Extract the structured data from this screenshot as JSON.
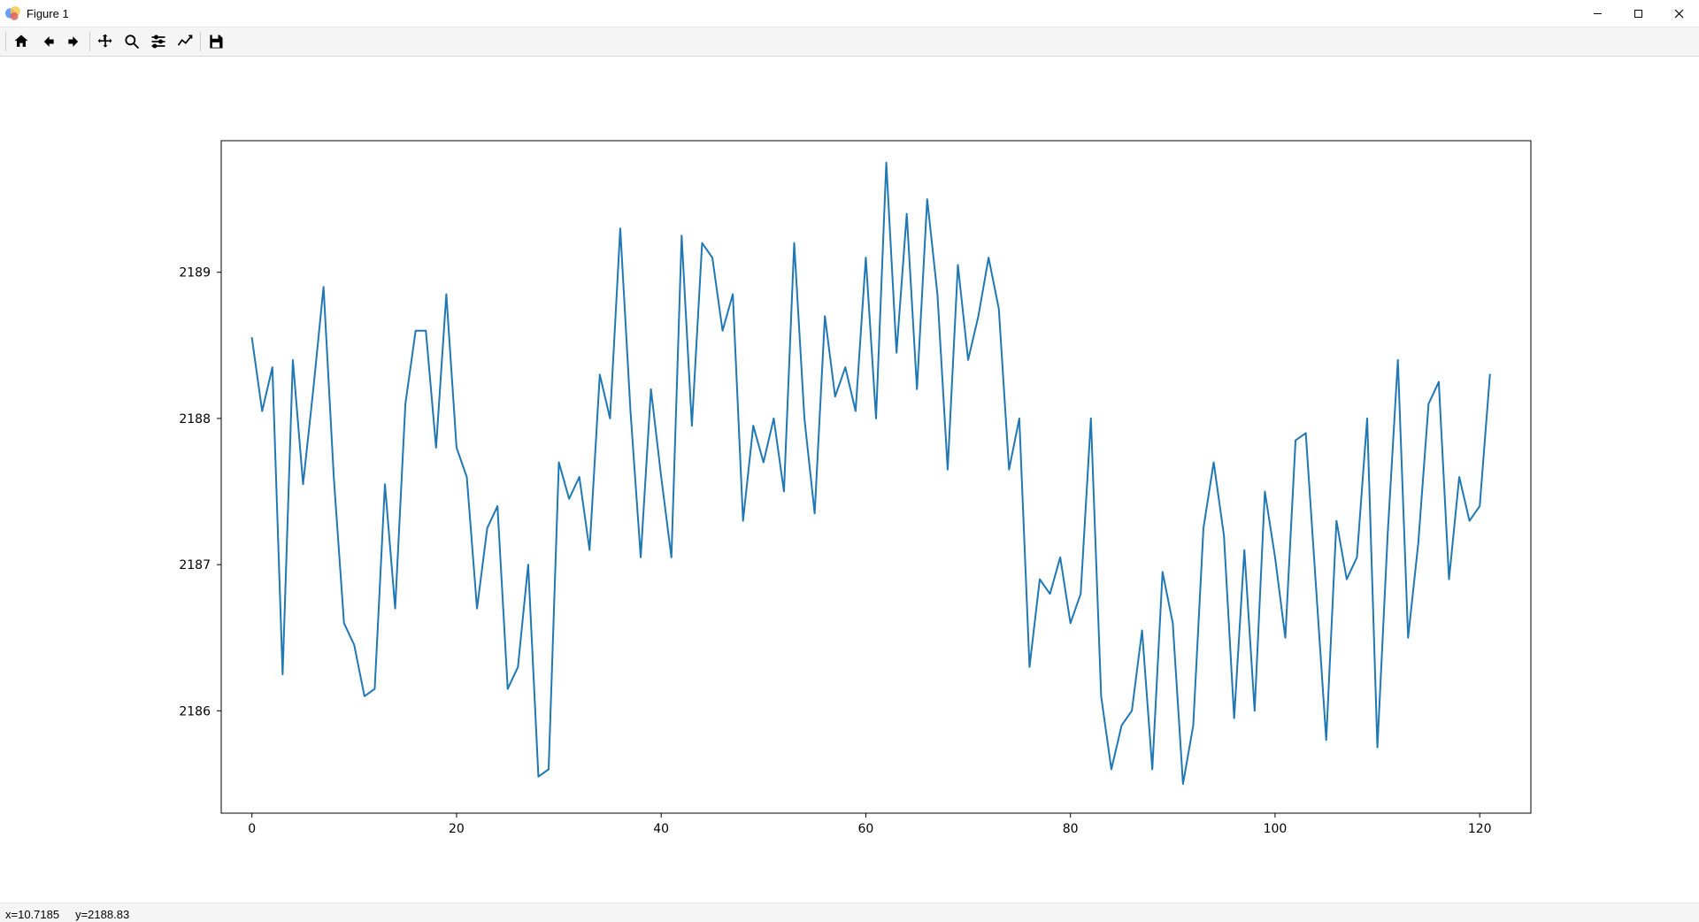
{
  "window": {
    "title": "Figure 1"
  },
  "status": {
    "x_label": "x=10.7185",
    "y_label": "y=2188.83"
  },
  "toolbar": {
    "icons": [
      "home",
      "back",
      "forward",
      "pan",
      "zoom",
      "configure",
      "edit-axes",
      "save"
    ]
  },
  "chart_data": {
    "type": "line",
    "title": "",
    "xlabel": "",
    "ylabel": "",
    "xlim": [
      -3,
      125
    ],
    "ylim": [
      2185.3,
      2189.9
    ],
    "xticks": [
      0,
      20,
      40,
      60,
      80,
      100,
      120
    ],
    "yticks": [
      2186,
      2187,
      2188,
      2189
    ],
    "line_color": "#1f77b4",
    "x": [
      0,
      1,
      2,
      3,
      4,
      5,
      6,
      7,
      8,
      9,
      10,
      11,
      12,
      13,
      14,
      15,
      16,
      17,
      18,
      19,
      20,
      21,
      22,
      23,
      24,
      25,
      26,
      27,
      28,
      29,
      30,
      31,
      32,
      33,
      34,
      35,
      36,
      37,
      38,
      39,
      40,
      41,
      42,
      43,
      44,
      45,
      46,
      47,
      48,
      49,
      50,
      51,
      52,
      53,
      54,
      55,
      56,
      57,
      58,
      59,
      60,
      61,
      62,
      63,
      64,
      65,
      66,
      67,
      68,
      69,
      70,
      71,
      72,
      73,
      74,
      75,
      76,
      77,
      78,
      79,
      80,
      81,
      82,
      83,
      84,
      85,
      86,
      87,
      88,
      89,
      90,
      91,
      92,
      93,
      94,
      95,
      96,
      97,
      98,
      99,
      100,
      101,
      102,
      103,
      104,
      105,
      106,
      107,
      108,
      109,
      110,
      111,
      112,
      113,
      114,
      115,
      116,
      117,
      118,
      119,
      120,
      121
    ],
    "values": [
      2188.55,
      2188.05,
      2188.35,
      2186.25,
      2188.4,
      2187.55,
      2188.2,
      2188.9,
      2187.6,
      2186.6,
      2186.45,
      2186.1,
      2186.15,
      2187.55,
      2186.7,
      2188.1,
      2188.6,
      2188.6,
      2187.8,
      2188.85,
      2187.8,
      2187.6,
      2186.7,
      2187.25,
      2187.4,
      2186.15,
      2186.3,
      2187.0,
      2185.55,
      2185.6,
      2187.7,
      2187.45,
      2187.6,
      2187.1,
      2188.3,
      2188.0,
      2189.3,
      2188.05,
      2187.05,
      2188.2,
      2187.6,
      2187.05,
      2189.25,
      2187.95,
      2189.2,
      2189.1,
      2188.6,
      2188.85,
      2187.3,
      2187.95,
      2187.7,
      2188.0,
      2187.5,
      2189.2,
      2188.0,
      2187.35,
      2188.7,
      2188.15,
      2188.35,
      2188.05,
      2189.1,
      2188.0,
      2189.75,
      2188.45,
      2189.4,
      2188.2,
      2189.5,
      2188.85,
      2187.65,
      2189.05,
      2188.4,
      2188.7,
      2189.1,
      2188.75,
      2187.65,
      2188.0,
      2186.3,
      2186.9,
      2186.8,
      2187.05,
      2186.6,
      2186.8,
      2188.0,
      2186.1,
      2185.6,
      2185.9,
      2186.0,
      2186.55,
      2185.6,
      2186.95,
      2186.6,
      2185.5,
      2185.9,
      2187.25,
      2187.7,
      2187.2,
      2185.95,
      2187.1,
      2186.0,
      2187.5,
      2187.05,
      2186.5,
      2187.85,
      2187.9,
      2186.85,
      2185.8,
      2187.3,
      2186.9,
      2187.05,
      2188.0,
      2185.75,
      2187.2,
      2188.4,
      2186.5,
      2187.15,
      2188.1,
      2188.25,
      2186.9,
      2187.6,
      2187.3,
      2187.4,
      2188.3
    ]
  }
}
